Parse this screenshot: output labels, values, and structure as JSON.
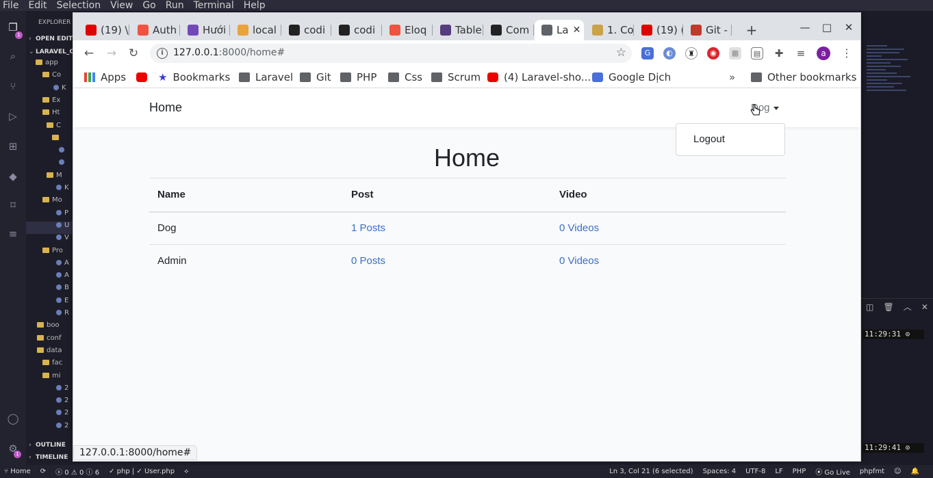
{
  "vscode": {
    "menu": [
      "File",
      "Edit",
      "Selection",
      "View",
      "Go",
      "Run",
      "Terminal",
      "Help"
    ],
    "sidebar": {
      "header": "EXPLORER",
      "open_editors": "OPEN EDITO",
      "project": "LARAVEL_C",
      "outline": "OUTLINE",
      "timeline": "TIMELINE",
      "tree": [
        "app",
        "Co",
        "K",
        "Ex",
        "Ht",
        "C",
        "",
        "",
        "",
        "M",
        "K",
        "Mo",
        "P",
        "U",
        "V",
        "Pro",
        "A",
        "A",
        "B",
        "E",
        "R",
        "boo",
        "conf",
        "data",
        "fac",
        "mi",
        "2",
        "2",
        "2",
        "2"
      ]
    },
    "terminal": {
      "clock1": "11:29:31",
      "clock2": "11:29:41"
    },
    "status": {
      "branch": "Home",
      "problems": "0 ⚠ 0 ⓘ 6",
      "lang_file": "php | ✓ User.php",
      "position": "Ln 3, Col 21 (6 selected)",
      "spaces": "Spaces: 4",
      "encoding": "UTF-8",
      "eol": "LF",
      "language": "PHP",
      "golive": "Go Live",
      "formatter": "phpfmt"
    }
  },
  "chrome": {
    "tabs": [
      {
        "label": "(19) \\",
        "color": "#e00000"
      },
      {
        "label": "Auth",
        "color": "#f05340"
      },
      {
        "label": "Hưới",
        "color": "#7248b9"
      },
      {
        "label": "local",
        "color": "#e8a33d"
      },
      {
        "label": "codi",
        "color": "#222222"
      },
      {
        "label": "codi",
        "color": "#222222"
      },
      {
        "label": "Eloq",
        "color": "#f05340"
      },
      {
        "label": "Table",
        "color": "#563d7c"
      },
      {
        "label": "Com",
        "color": "#222222"
      },
      {
        "label": "La",
        "color": "#5f6368",
        "active": true
      },
      {
        "label": "1. Co",
        "color": "#c9a24b"
      },
      {
        "label": "(19) (",
        "color": "#e00000"
      },
      {
        "label": "Git - /",
        "color": "#c0392b"
      }
    ],
    "address": {
      "host": "127.0.0.1",
      "path": ":8000/home#"
    },
    "profile_initial": "a",
    "bookmarks": {
      "apps": "Apps",
      "items": [
        "Bookmarks",
        "Laravel",
        "Git",
        "PHP",
        "Css",
        "Scrum",
        "(4) Laravel-sho...",
        "Google Dịch"
      ],
      "more": "»",
      "other": "Other bookmarks"
    },
    "status_url": "127.0.0.1:8000/home#"
  },
  "app": {
    "brand": "Home",
    "user": "Dog",
    "dropdown_item": "Logout",
    "title": "Home",
    "table": {
      "headers": [
        "Name",
        "Post",
        "Video"
      ],
      "rows": [
        {
          "name": "Dog",
          "posts": "1 Posts",
          "videos": "0 Videos"
        },
        {
          "name": "Admin",
          "posts": "0 Posts",
          "videos": "0 Videos"
        }
      ]
    }
  }
}
